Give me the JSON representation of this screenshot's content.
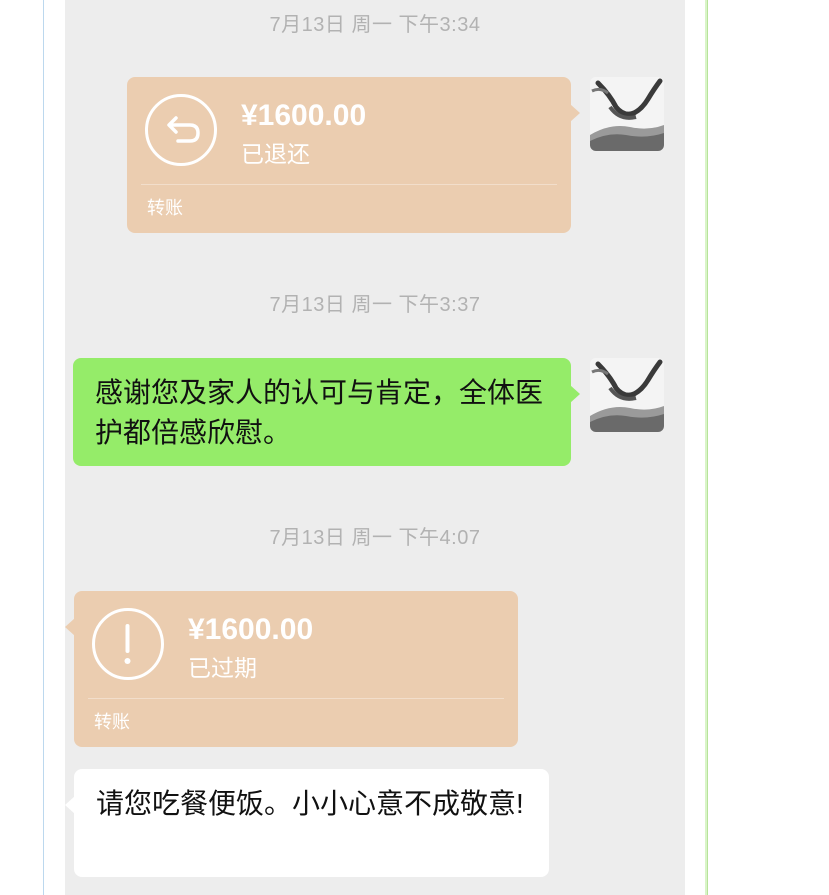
{
  "chat": {
    "timestamps": [
      "7月13日 周一 下午3:34",
      "7月13日 周一 下午3:37",
      "7月13日 周一 下午4:07"
    ],
    "messages": [
      {
        "type": "transfer",
        "side": "right",
        "amount": "¥1600.00",
        "status": "已退还",
        "label": "转账",
        "icon": "return-arrow-icon"
      },
      {
        "type": "text",
        "side": "right",
        "text": "感谢您及家人的认可与肯定，全体医护都倍感欣慰。"
      },
      {
        "type": "transfer",
        "side": "left",
        "amount": "¥1600.00",
        "status": "已过期",
        "label": "转账",
        "icon": "exclamation-icon"
      },
      {
        "type": "text",
        "side": "left",
        "text": "请您吃餐便饭。小小心意不成敬意!"
      }
    ]
  },
  "colors": {
    "chat_background": "#ededed",
    "transfer_bubble": "#ebcdb0",
    "own_message_bubble": "#95ec69",
    "other_message_bubble": "#ffffff",
    "timestamp_text": "#b2b2b2"
  }
}
